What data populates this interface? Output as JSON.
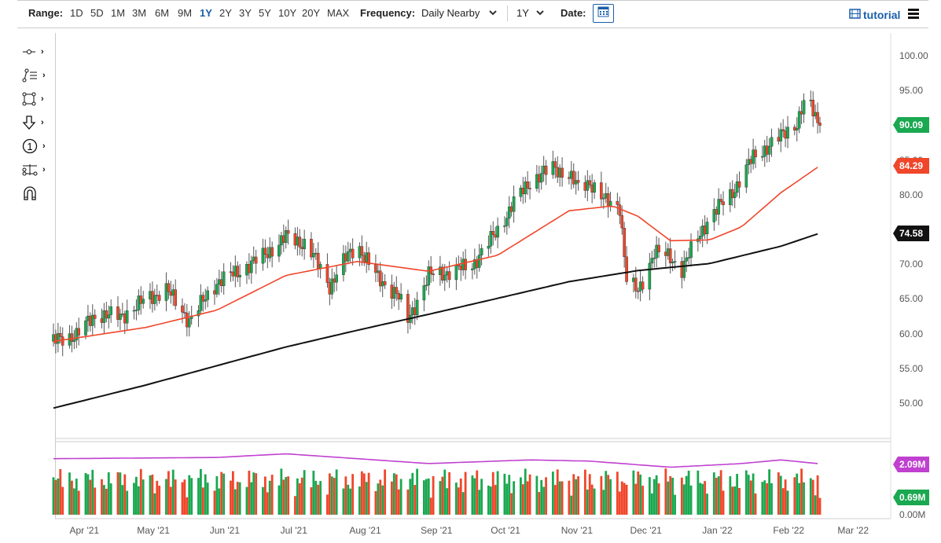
{
  "toolbar": {
    "range_label": "Range:",
    "ranges": [
      "1D",
      "5D",
      "1M",
      "3M",
      "6M",
      "9M",
      "1Y",
      "2Y",
      "3Y",
      "5Y",
      "10Y",
      "20Y",
      "MAX"
    ],
    "active_range": "1Y",
    "frequency_label": "Frequency:",
    "frequency_value": "Daily Nearby",
    "period_value": "1Y",
    "date_label": "Date:",
    "tutorial_label": "tutorial"
  },
  "tools": [
    "crosshair-tool",
    "trendline-tool",
    "rectangle-tool",
    "arrow-tool",
    "number-marker-tool",
    "measure-tool",
    "magnet-tool"
  ],
  "colors": {
    "up": "#1aa850",
    "down": "#f0462a",
    "ma50": "#f0462a",
    "ma200": "#111111",
    "vol_avg": "#c040d0",
    "accent": "#1a5faa"
  },
  "y_axis": {
    "labels": [
      "100.00",
      "95.00",
      "90.00",
      "85.00",
      "80.00",
      "75.00",
      "70.00",
      "65.00",
      "60.00",
      "55.00",
      "50.00"
    ]
  },
  "tags": {
    "last_price": "90.09",
    "ma50": "84.29",
    "ma200": "74.58",
    "vol_avg": "2.09M",
    "vol_last": "0.69M"
  },
  "volume_axis": {
    "zero": "0.00M"
  },
  "x_axis": {
    "labels": [
      "Apr '21",
      "May '21",
      "Jun '21",
      "Jul '21",
      "Aug '21",
      "Sep '21",
      "Oct '21",
      "Nov '21",
      "Dec '21",
      "Jan '22",
      "Feb '22",
      "Mar '22"
    ],
    "dates": [
      "2021-04-01",
      "2021-05-01",
      "2021-06-01",
      "2021-07-01",
      "2021-08-01",
      "2021-09-01",
      "2021-10-01",
      "2021-11-01",
      "2021-12-01",
      "2022-01-01",
      "2022-02-01",
      "2022-03-01"
    ]
  },
  "chart_data": {
    "type": "candlestick",
    "ylim": [
      45,
      102
    ],
    "price_keypoints": [
      [
        "2021-03-22",
        59
      ],
      [
        "2021-04-01",
        60
      ],
      [
        "2021-04-10",
        63
      ],
      [
        "2021-04-20",
        62.5
      ],
      [
        "2021-05-01",
        65
      ],
      [
        "2021-05-10",
        66.5
      ],
      [
        "2021-05-20",
        62
      ],
      [
        "2021-06-01",
        67.5
      ],
      [
        "2021-06-10",
        69
      ],
      [
        "2021-06-20",
        71
      ],
      [
        "2021-07-01",
        74
      ],
      [
        "2021-07-10",
        73
      ],
      [
        "2021-07-20",
        67
      ],
      [
        "2021-07-25",
        70
      ],
      [
        "2021-08-01",
        73
      ],
      [
        "2021-08-10",
        68
      ],
      [
        "2021-08-18",
        66
      ],
      [
        "2021-08-23",
        62
      ],
      [
        "2021-09-01",
        68.5
      ],
      [
        "2021-09-10",
        69
      ],
      [
        "2021-09-20",
        70
      ],
      [
        "2021-10-01",
        75
      ],
      [
        "2021-10-08",
        79
      ],
      [
        "2021-10-15",
        82
      ],
      [
        "2021-10-25",
        84
      ],
      [
        "2021-11-01",
        83
      ],
      [
        "2021-11-05",
        81
      ],
      [
        "2021-11-10",
        82
      ],
      [
        "2021-11-17",
        79
      ],
      [
        "2021-11-23",
        78.5
      ],
      [
        "2021-11-26",
        68
      ],
      [
        "2021-12-01",
        66
      ],
      [
        "2021-12-08",
        72
      ],
      [
        "2021-12-15",
        71
      ],
      [
        "2021-12-20",
        69.5
      ],
      [
        "2022-01-01",
        77
      ],
      [
        "2022-01-10",
        80
      ],
      [
        "2022-01-20",
        85.5
      ],
      [
        "2022-02-01",
        88.5
      ],
      [
        "2022-02-08",
        90.5
      ],
      [
        "2022-02-12",
        94
      ],
      [
        "2022-02-18",
        90.09
      ]
    ],
    "ma50": [
      [
        "2021-03-22",
        59
      ],
      [
        "2021-05-01",
        61
      ],
      [
        "2021-06-01",
        63.5
      ],
      [
        "2021-07-01",
        68.5
      ],
      [
        "2021-08-01",
        70.5
      ],
      [
        "2021-09-01",
        69.1
      ],
      [
        "2021-10-01",
        71.4
      ],
      [
        "2021-11-01",
        77.8
      ],
      [
        "2021-11-20",
        78.5
      ],
      [
        "2021-12-01",
        77
      ],
      [
        "2021-12-15",
        73.5
      ],
      [
        "2022-01-01",
        73.6
      ],
      [
        "2022-01-15",
        75.5
      ],
      [
        "2022-02-01",
        80.4
      ],
      [
        "2022-02-18",
        84.29
      ]
    ],
    "ma200": [
      [
        "2021-03-22",
        49.4
      ],
      [
        "2021-05-01",
        52.7
      ],
      [
        "2021-06-01",
        55.5
      ],
      [
        "2021-07-01",
        58.2
      ],
      [
        "2021-08-01",
        60.6
      ],
      [
        "2021-09-01",
        62.9
      ],
      [
        "2021-10-01",
        65.2
      ],
      [
        "2021-11-01",
        67.6
      ],
      [
        "2021-12-01",
        69.2
      ],
      [
        "2022-01-01",
        70.2
      ],
      [
        "2022-02-01",
        72.7
      ],
      [
        "2022-02-18",
        74.58
      ]
    ],
    "volume_avg_M": [
      [
        "2021-03-22",
        2.3
      ],
      [
        "2021-06-01",
        2.35
      ],
      [
        "2021-07-01",
        2.5
      ],
      [
        "2021-08-01",
        2.3
      ],
      [
        "2021-09-01",
        2.1
      ],
      [
        "2021-10-15",
        2.25
      ],
      [
        "2021-11-10",
        2.2
      ],
      [
        "2021-12-15",
        1.95
      ],
      [
        "2022-01-15",
        2.1
      ],
      [
        "2022-02-01",
        2.25
      ],
      [
        "2022-02-18",
        2.09
      ]
    ],
    "volume_last_M": 0.69
  }
}
